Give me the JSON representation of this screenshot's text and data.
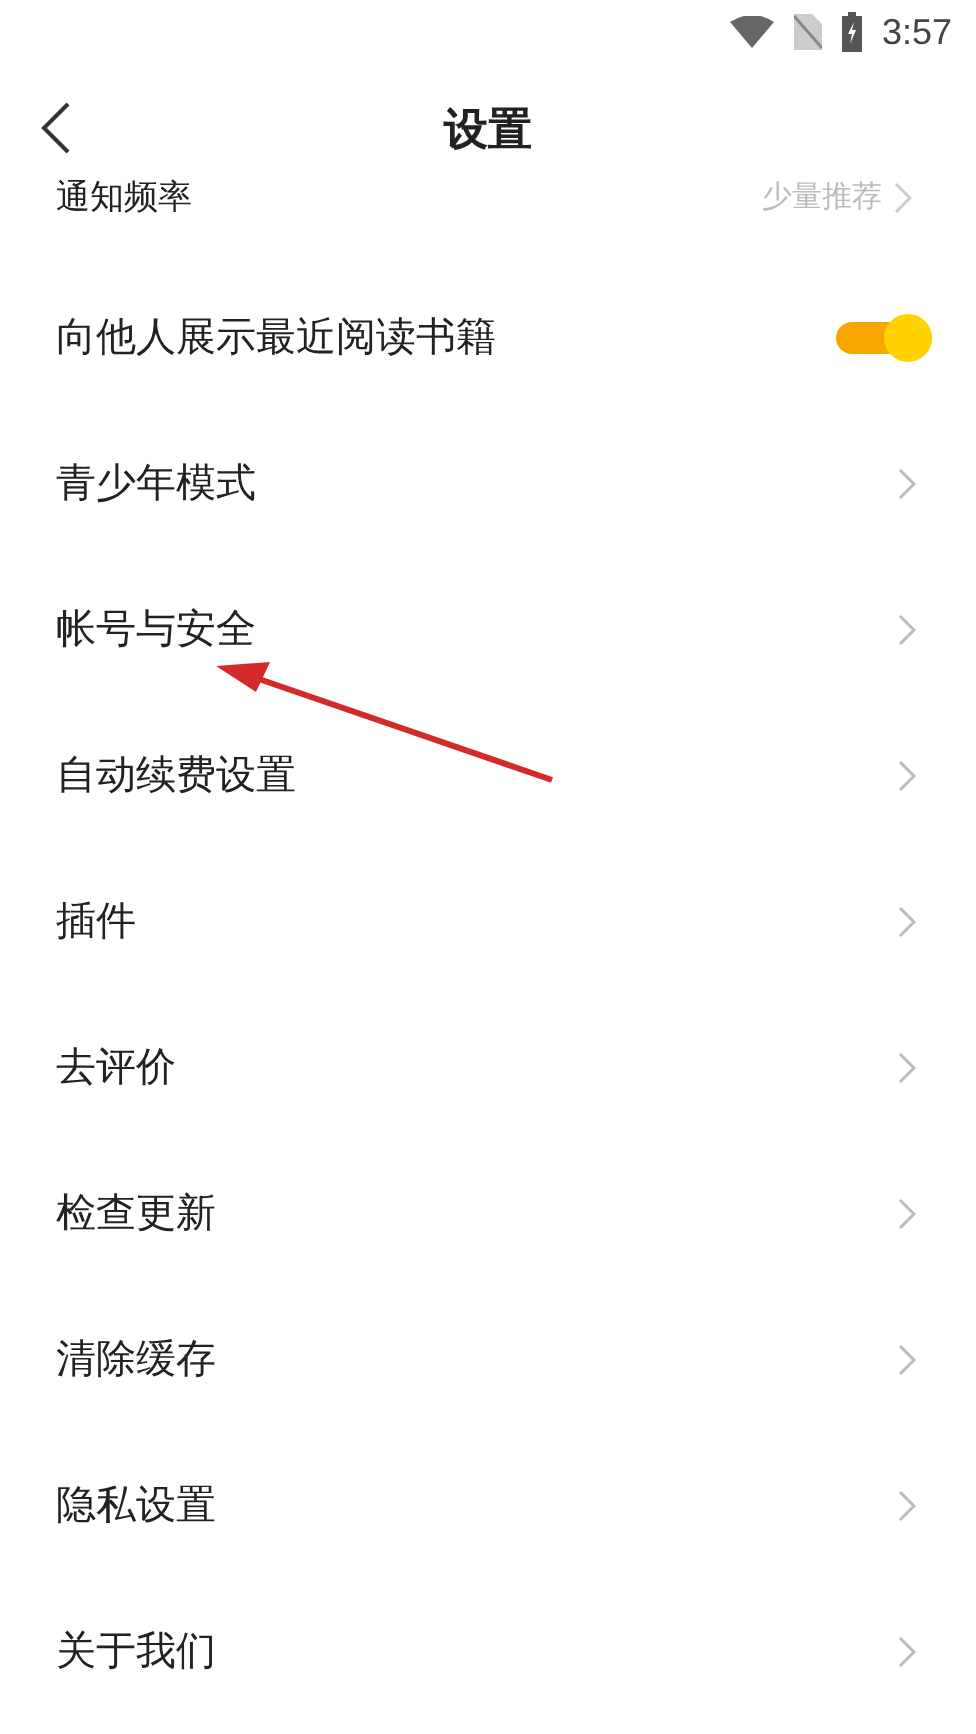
{
  "status_bar": {
    "time": "3:57"
  },
  "header": {
    "title": "设置"
  },
  "rows": [
    {
      "kind": "value",
      "label": "通知频率",
      "value": "少量推荐"
    },
    {
      "kind": "toggle",
      "label": "向他人展示最近阅读书籍",
      "on": true
    },
    {
      "kind": "link",
      "label": "青少年模式"
    },
    {
      "kind": "link",
      "label": "帐号与安全"
    },
    {
      "kind": "link",
      "label": "自动续费设置"
    },
    {
      "kind": "link",
      "label": "插件"
    },
    {
      "kind": "link",
      "label": "去评价"
    },
    {
      "kind": "link",
      "label": "检查更新"
    },
    {
      "kind": "link",
      "label": "清除缓存"
    },
    {
      "kind": "link",
      "label": "隐私设置"
    },
    {
      "kind": "link",
      "label": "关于我们"
    }
  ]
}
